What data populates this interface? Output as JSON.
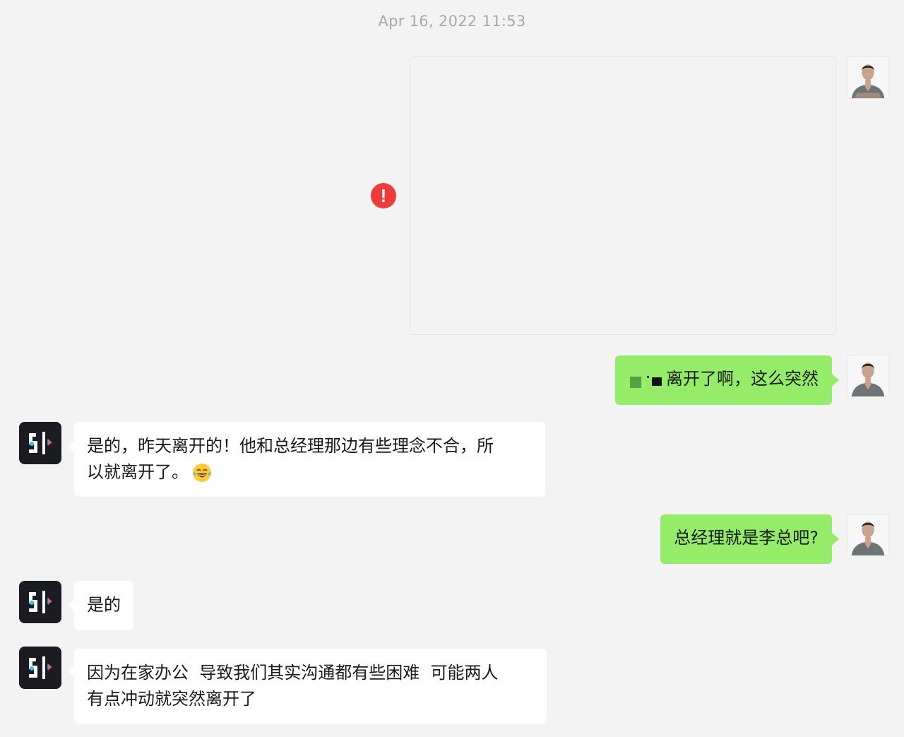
{
  "timestamp": "Apr 16, 2022 11:53",
  "messages": [
    {
      "side": "self",
      "type": "image",
      "status": "failed"
    },
    {
      "side": "self",
      "type": "text",
      "text": "离开了啊，这么突然",
      "redacted_prefix": true
    },
    {
      "side": "other",
      "type": "text",
      "text_line1": "是的，昨天离开的！他和总经理那边有些理念不合，所",
      "text_line2": "以就离开了。",
      "emoji": "face-with-tears-of-joy"
    },
    {
      "side": "self",
      "type": "text",
      "text": "总经理就是李总吧?"
    },
    {
      "side": "other",
      "type": "text",
      "text": "是的"
    },
    {
      "side": "other",
      "type": "text",
      "text_line1": "因为在家办公  导致我们其实沟通都有些困难  可能两人",
      "text_line2": "有点冲动就突然离开了"
    }
  ],
  "icons": {
    "error": "!",
    "error_color": "#f03b3b",
    "self_bubble_color": "#95ec69",
    "other_bubble_color": "#ffffff"
  }
}
